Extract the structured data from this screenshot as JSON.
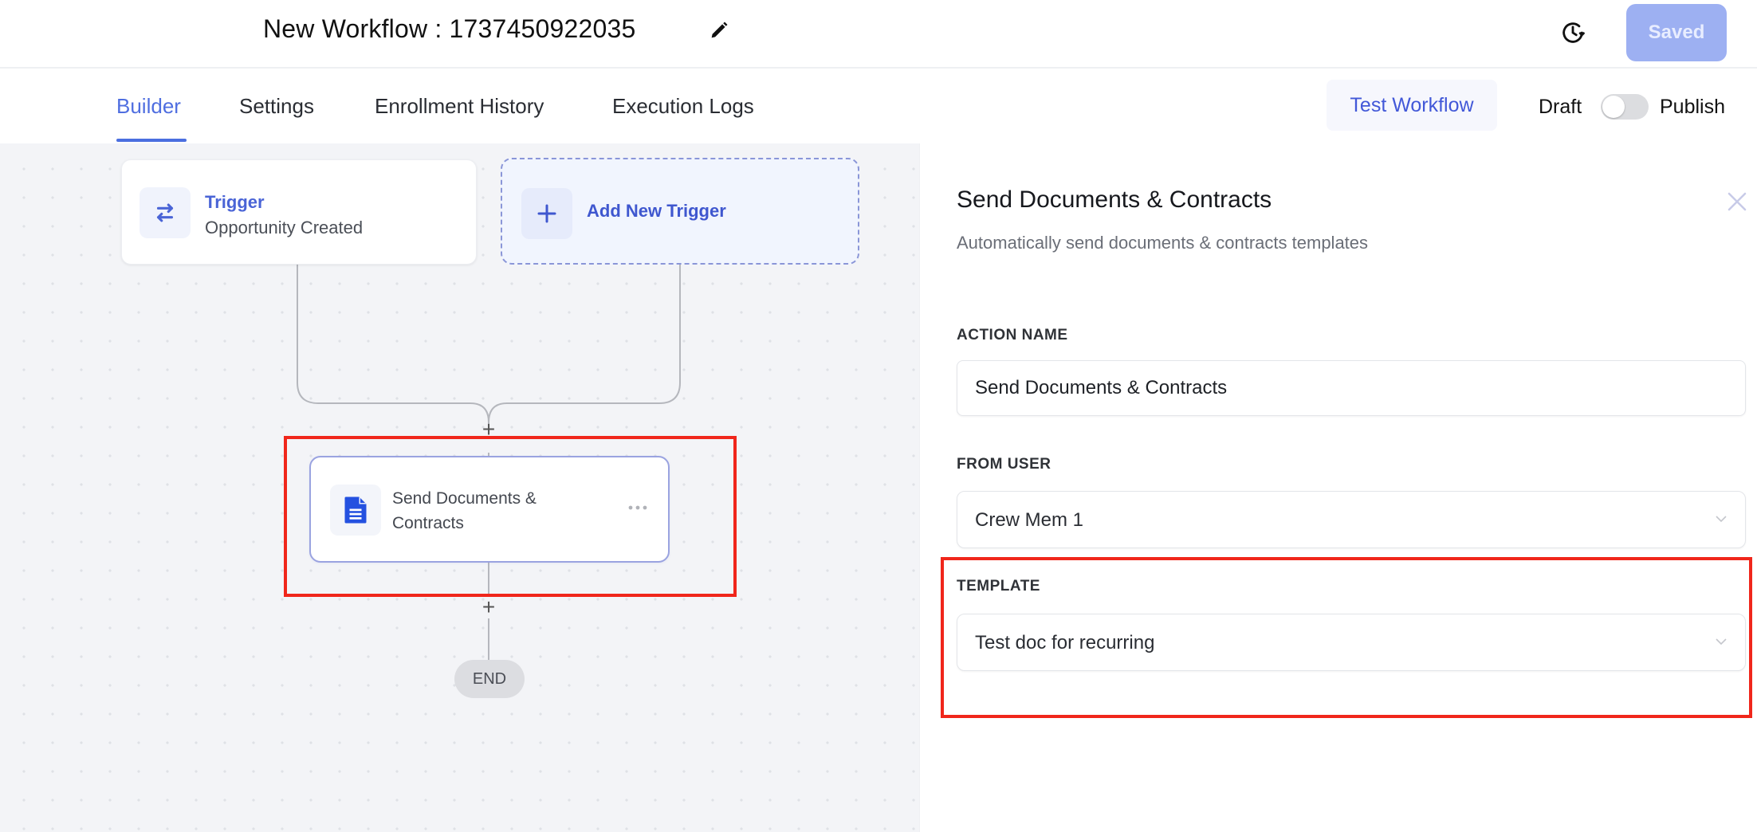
{
  "header": {
    "workflow_title": "New Workflow : 1737450922035",
    "edit_icon": "pencil-icon",
    "history_icon": "history-clock-icon",
    "saved_button": "Saved"
  },
  "tabs": [
    {
      "label": "Builder",
      "active": true
    },
    {
      "label": "Settings",
      "active": false
    },
    {
      "label": "Enrollment History",
      "active": false
    },
    {
      "label": "Execution Logs",
      "active": false
    }
  ],
  "toolbar": {
    "test_workflow": "Test Workflow",
    "draft_label": "Draft",
    "publish_label": "Publish",
    "publish_toggle_on": false
  },
  "canvas": {
    "trigger": {
      "title": "Trigger",
      "subtitle": "Opportunity Created",
      "icon": "swap-arrows-icon"
    },
    "add_trigger": {
      "label": "Add New Trigger",
      "icon": "plus-icon"
    },
    "add_step_symbol": "+",
    "action": {
      "label": "Send Documents & Contracts",
      "icon": "document-icon"
    },
    "end_label": "END"
  },
  "panel": {
    "title": "Send Documents & Contracts",
    "description": "Automatically send documents & contracts templates",
    "fields": {
      "action_name": {
        "label": "ACTION NAME",
        "value": "Send Documents & Contracts"
      },
      "from_user": {
        "label": "FROM USER",
        "value": "Crew Mem 1"
      },
      "template": {
        "label": "TEMPLATE",
        "value": "Test doc for recurring"
      }
    }
  },
  "colors": {
    "accent": "#4b6fe0",
    "saved_button_bg": "#9db0f2",
    "highlight": "#f0261b",
    "canvas_bg": "#f3f4f7"
  }
}
